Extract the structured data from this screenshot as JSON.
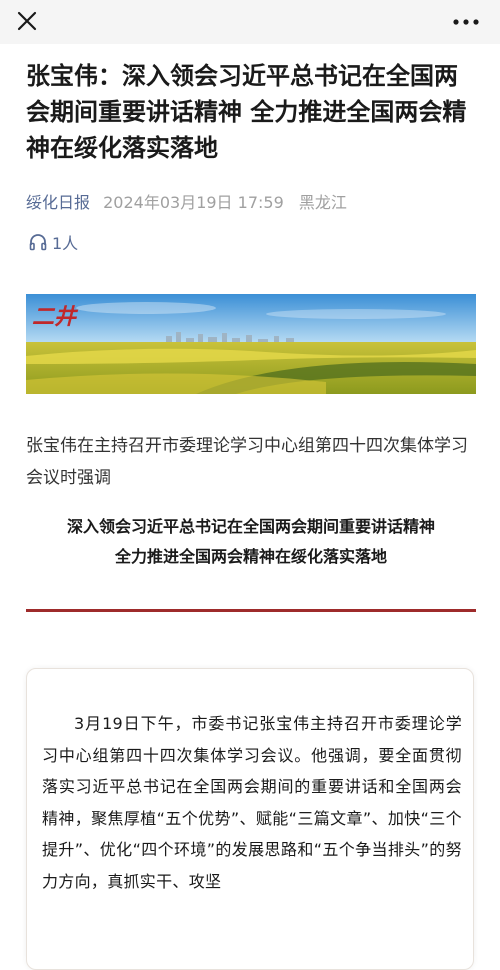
{
  "topbar": {
    "close_icon": "close-icon",
    "more_icon": "more-dots-icon"
  },
  "article": {
    "title": "张宝伟：深入领会习近平总书记在全国两会期间重要讲话精神 全力推进全国两会精神在绥化落实落地",
    "source": "绥化日报",
    "date": "2024年03月19日 17:59",
    "region": "黑龙江",
    "listen_count": "1人",
    "listen_icon": "headphones-icon",
    "banner_text": "二井",
    "intro": "张宝伟在主持召开市委理论学习中心组第四十四次集体学习会议时强调",
    "headline_line1": "深入领会习近平总书记在全国两会期间重要讲话精神",
    "headline_line2": "全力推进全国两会精神在绥化落实落地",
    "body": "3月19日下午，市委书记张宝伟主持召开市委理论学习中心组第四十四次集体学习会议。他强调，要全面贯彻落实习近平总书记在全国两会期间的重要讲话和全国两会精神，聚焦厚植“五个优势”、赋能“三篇文章”、加快“三个提升”、优化“四个环境”的发展思路和“五个争当排头”的努力方向，真抓实干、攻坚"
  },
  "colors": {
    "link": "#576b95",
    "meta_gray": "#a0a0a0",
    "divider": "#9e2b2b",
    "topbar_bg": "#f5f5f5"
  }
}
